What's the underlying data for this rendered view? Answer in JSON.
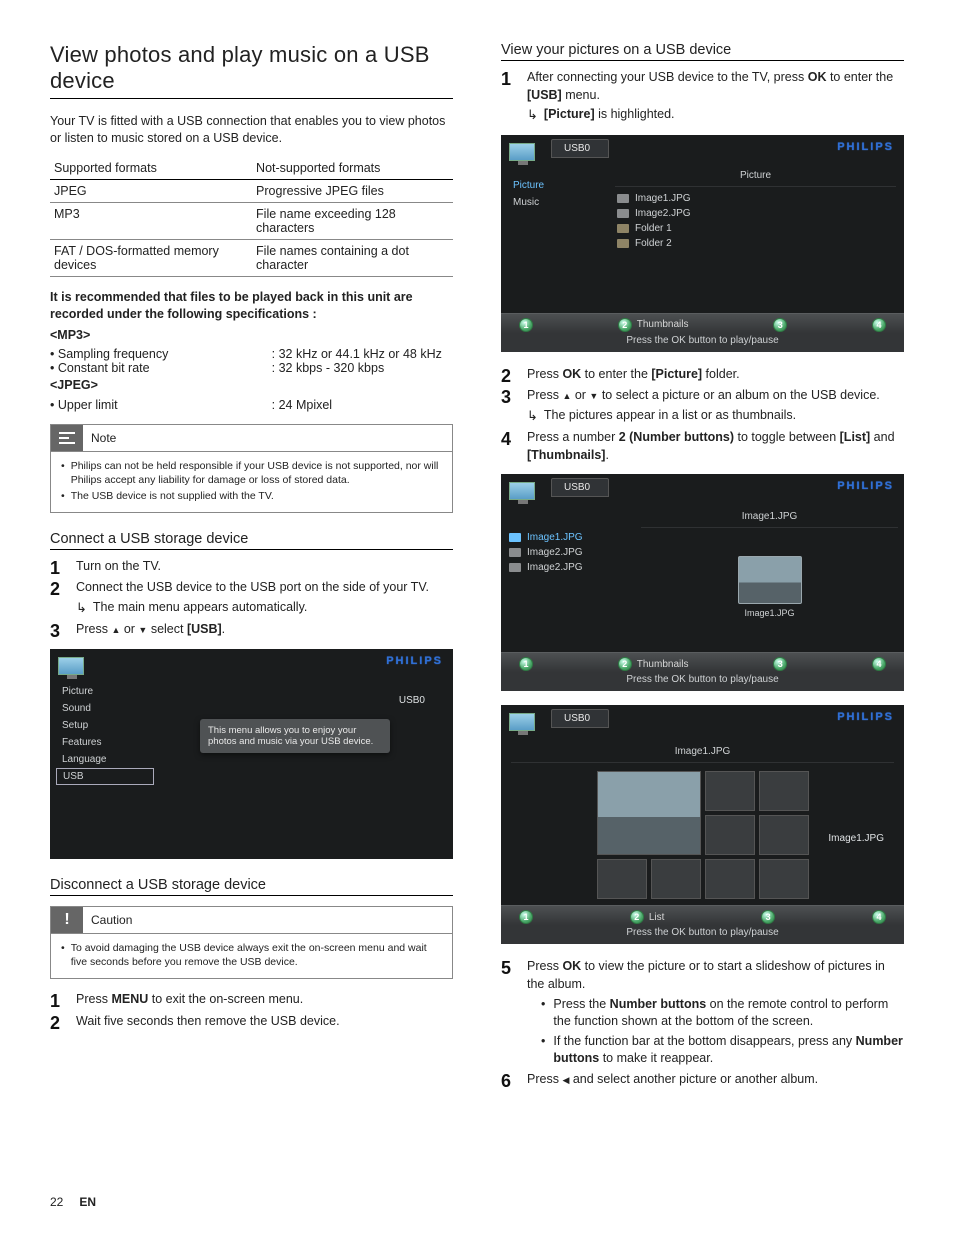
{
  "footer": {
    "page": "22",
    "lang": "EN"
  },
  "left": {
    "h1": "View photos and play music on a USB device",
    "intro": "Your TV is fitted with a USB connection that enables you to view photos or listen to music stored on a USB device.",
    "fmt": {
      "h_supported": "Supported formats",
      "h_unsupported": "Not-supported formats",
      "rows": [
        [
          "JPEG",
          "Progressive JPEG files"
        ],
        [
          "MP3",
          "File name exceeding 128 characters"
        ],
        [
          "FAT / DOS-formatted memory devices",
          "File names containing a dot character"
        ]
      ]
    },
    "spec_title": "It is recommended that files to be played back in this unit are recorded under the following specifications :",
    "mp3_label": "<MP3>",
    "mp3_rows": [
      [
        "Sampling frequency",
        ": 32 kHz or 44.1 kHz or 48 kHz"
      ],
      [
        "Constant bit rate",
        ": 32 kbps - 320 kbps"
      ]
    ],
    "jpeg_label": "<JPEG>",
    "jpeg_rows": [
      [
        "Upper limit",
        ": 24 Mpixel"
      ]
    ],
    "note": {
      "title": "Note",
      "items": [
        "Philips can not be held responsible if your USB device is not supported, nor will Philips accept any liability for damage or loss of stored data.",
        "The USB device is not supplied with the TV."
      ]
    },
    "h2_connect": "Connect a USB storage device",
    "connect_steps": {
      "s1": "Turn on the TV.",
      "s2": "Connect the USB device to the USB port on the side of your TV.",
      "s2_sub": "The main menu appears automatically.",
      "s3_a": "Press ",
      "s3_b": " or ",
      "s3_c": " select ",
      "s3_d": "[USB]",
      "s3_e": "."
    },
    "tv1": {
      "brand": "PHILIPS",
      "side": [
        "Picture",
        "Sound",
        "Setup",
        "Features",
        "Language",
        "USB"
      ],
      "right_label": "USB0",
      "tooltip": "This menu allows you to enjoy your photos and music via your USB device."
    },
    "h2_disconnect": "Disconnect a USB storage device",
    "caution": {
      "title": "Caution",
      "items": [
        "To avoid damaging the USB device always exit the on-screen menu and wait five seconds before you remove the USB device."
      ]
    },
    "disconnect_steps": {
      "s1_a": "Press ",
      "s1_b": "MENU",
      "s1_c": " to exit the on-screen menu.",
      "s2": "Wait five seconds then remove the USB device."
    }
  },
  "right": {
    "h2_view": "View your pictures on a USB device",
    "step1_a": "After connecting your USB device to the TV, press ",
    "step1_ok": "OK",
    "step1_b": " to enter the ",
    "step1_usb": "[USB]",
    "step1_c": " menu.",
    "step1_sub_a": "[Picture]",
    "step1_sub_b": " is highlighted.",
    "tv2": {
      "brand": "PHILIPS",
      "tab": "USB0",
      "side": [
        "Picture",
        "Music"
      ],
      "hdr": "Picture",
      "files": [
        {
          "name": "Image1.JPG",
          "type": "img"
        },
        {
          "name": "Image2.JPG",
          "type": "img"
        },
        {
          "name": "Folder 1",
          "type": "folder"
        },
        {
          "name": "Folder 2",
          "type": "folder"
        }
      ],
      "bar_label": "Thumbnails",
      "hint": "Press the OK button to play/pause",
      "nums": [
        "1",
        "2",
        "3",
        "4"
      ]
    },
    "step2_a": "Press ",
    "step2_ok": "OK",
    "step2_b": " to enter the ",
    "step2_pic": "[Picture]",
    "step2_c": " folder.",
    "step3_a": "Press ",
    "step3_b": " or ",
    "step3_c": " to select a picture or an album on the USB device.",
    "step3_sub": "The pictures appear in a list or as thumbnails.",
    "step4_a": "Press a number ",
    "step4_two": "2 (Number buttons)",
    "step4_b": " to toggle between ",
    "step4_list": "[List]",
    "step4_c": " and ",
    "step4_thumb": "[Thumbnails]",
    "step4_d": ".",
    "tv3": {
      "brand": "PHILIPS",
      "tab": "USB0",
      "hdr": "Image1.JPG",
      "files": [
        {
          "name": "Image1.JPG",
          "sel": true
        },
        {
          "name": "Image2.JPG"
        },
        {
          "name": "Image2.JPG"
        }
      ],
      "thumb_cap": "Image1.JPG",
      "bar_label": "Thumbnails",
      "hint": "Press the OK button to play/pause",
      "nums": [
        "1",
        "2",
        "3",
        "4"
      ]
    },
    "tv4": {
      "brand": "PHILIPS",
      "tab": "USB0",
      "hdr": "Image1.JPG",
      "grid_caption": "Image1.JPG",
      "bar_label": "List",
      "hint": "Press the OK button to play/pause",
      "nums": [
        "1",
        "2",
        "3",
        "4"
      ]
    },
    "step5_a": "Press ",
    "step5_ok": "OK",
    "step5_b": " to view the picture or to start a slideshow of pictures in the album.",
    "step5_b1_a": "Press the ",
    "step5_b1_nb": "Number buttons",
    "step5_b1_b": " on the remote control to perform the function shown at the bottom of the screen.",
    "step5_b2_a": "If the function bar at the bottom disappears, press any ",
    "step5_b2_nb": "Number buttons",
    "step5_b2_b": " to make it reappear.",
    "step6_a": "Press ",
    "step6_b": " and select another picture or another album."
  }
}
